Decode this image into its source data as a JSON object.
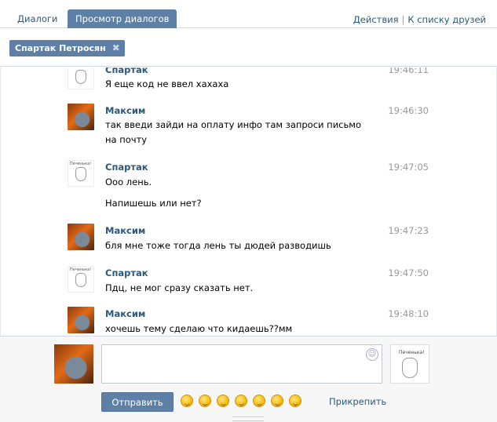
{
  "tabs": {
    "dialogs": "Диалоги",
    "view": "Просмотр диалогов",
    "actions": "Действия",
    "friends_list": "К списку друзей",
    "separator": "|"
  },
  "peer": {
    "chip_label": "Спартак Петросян",
    "close_glyph": "✖"
  },
  "messages": [
    {
      "author": "Спартак",
      "time": "19:46:11",
      "lines": [
        "Я еще код не ввел хахаха"
      ]
    },
    {
      "author": "Максим",
      "time": "19:46:30",
      "lines": [
        "так введи зайди на оплату инфо там запроси письмо на почту"
      ]
    },
    {
      "author": "Спартак",
      "time": "19:47:05",
      "lines": [
        "Ооо лень.",
        "Напишешь или нет?"
      ]
    },
    {
      "author": "Максим",
      "time": "19:47:23",
      "lines": [
        "бля мне тоже тогда лень ты дюдей разводишь"
      ]
    },
    {
      "author": "Спартак",
      "time": "19:47:50",
      "lines": [
        "Пдц, не мог сразу сказать нет."
      ]
    },
    {
      "author": "Максим",
      "time": "19:48:10",
      "lines": [
        "хочешь тему сделаю что кидаешь??мм"
      ]
    }
  ],
  "composer": {
    "input_value": "",
    "send_label": "Отправить",
    "attach_label": "Прикрепить",
    "peer_avatar_caption": "Печенька!",
    "smile_glyph": "☺"
  },
  "avatar_caption": "Печенька!",
  "colors": {
    "accent": "#5e80a6",
    "link": "#2b587a",
    "time": "#999999"
  }
}
